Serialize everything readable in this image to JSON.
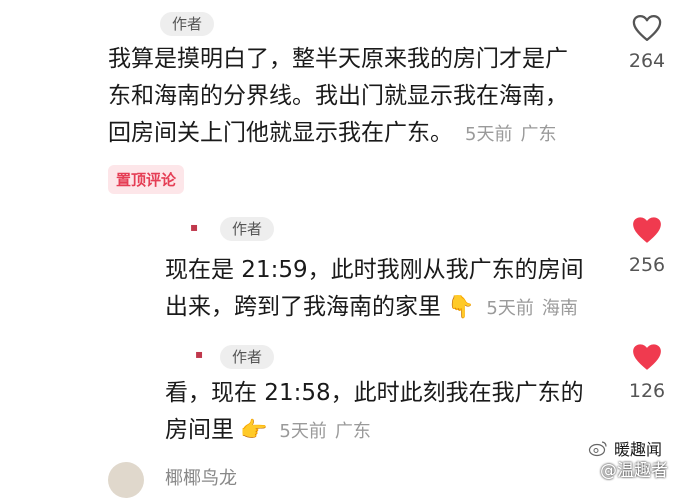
{
  "comments": [
    {
      "author_tag": "作者",
      "lines": [
        "我算是摸明白了，整半天原来我的房门才是广",
        "东和海南的分界线。我出门就显示我在海南，",
        "回房间关上门他就显示我在广东。"
      ],
      "time": "5天前",
      "location": "广东",
      "likes": "264",
      "liked": false,
      "pin_badge": "置顶评论"
    },
    {
      "author_tag": "作者",
      "avatar_text": "▪",
      "lines": [
        "现在是 21:59，此时我刚从我广东的房间",
        "出来，跨到了我海南的家里"
      ],
      "emoji": "👇",
      "time": "5天前",
      "location": "海南",
      "likes": "256",
      "liked": true
    },
    {
      "author_tag": "作者",
      "avatar_text": "▪",
      "lines": [
        "看，现在 21:58，此时此刻我在我广东的",
        "房间里"
      ],
      "emoji": "👉",
      "time": "5天前",
      "location": "广东",
      "likes": "126",
      "liked": true
    }
  ],
  "next_comment": {
    "username": "椰椰鸟龙"
  },
  "watermark": {
    "brand": "暖趣闻",
    "handle": "@温趣者"
  },
  "colors": {
    "heart_active": "#f03a4f",
    "heart_outline": "#555555",
    "pin_badge_bg": "#fde6e9",
    "pin_badge_text": "#e53e55"
  },
  "icons": {
    "like_outline": "heart-outline-icon",
    "like_filled": "heart-filled-icon",
    "watermark": "weibo-icon"
  }
}
